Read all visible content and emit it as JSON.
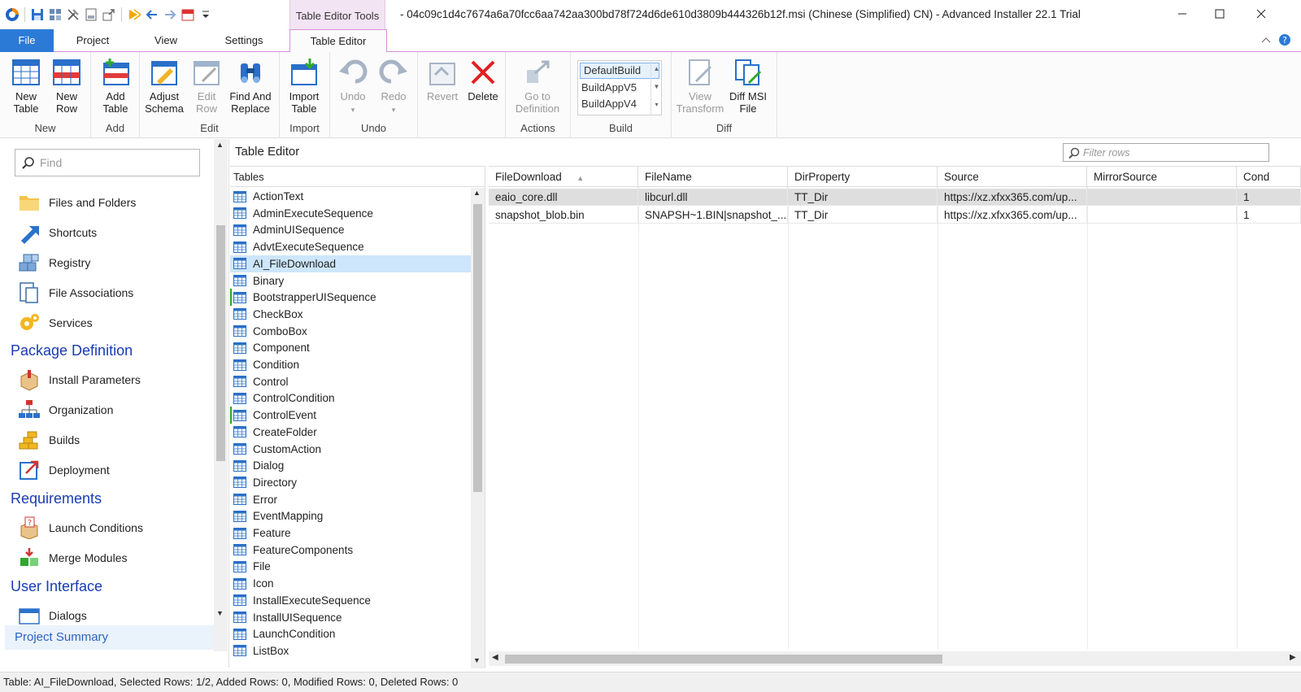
{
  "window": {
    "title": "- 04c09c1d4c7674a6a70fcc6aa742aa300bd78f724d6de610d3809b444326b12f.msi (Chinese (Simplified) CN) - Advanced Installer 22.1 Trial",
    "context_tab_title": "Table Editor Tools"
  },
  "tabs": [
    {
      "label": "File"
    },
    {
      "label": "Project"
    },
    {
      "label": "View"
    },
    {
      "label": "Settings"
    },
    {
      "label": "Table Editor"
    }
  ],
  "ribbon": {
    "new": {
      "label": "New",
      "new_table": "New\nTable",
      "new_row": "New\nRow"
    },
    "add": {
      "label": "Add",
      "add_table": "Add\nTable"
    },
    "edit": {
      "label": "Edit",
      "adjust_schema": "Adjust\nSchema",
      "edit_row": "Edit\nRow",
      "find_replace": "Find And\nReplace"
    },
    "import": {
      "label": "Import",
      "import_table": "Import\nTable"
    },
    "undo": {
      "label": "Undo",
      "undo": "Undo",
      "redo": "Redo"
    },
    "misc": {
      "revert": "Revert",
      "delete": "Delete"
    },
    "actions": {
      "label": "Actions",
      "go_to_definition": "Go to\nDefinition"
    },
    "build": {
      "label": "Build",
      "items": [
        "DefaultBuild",
        "BuildAppV5",
        "BuildAppV4"
      ],
      "selected": "DefaultBuild"
    },
    "diff": {
      "label": "Diff",
      "view_transform": "View\nTransform",
      "diff_msi": "Diff MSI\nFile"
    }
  },
  "leftpane": {
    "find_placeholder": "Find",
    "items_top": [
      {
        "label": "Files and Folders",
        "icon": "folder-icon"
      },
      {
        "label": "Shortcuts",
        "icon": "shortcut-arrow-icon"
      },
      {
        "label": "Registry",
        "icon": "registry-cubes-icon"
      },
      {
        "label": "File Associations",
        "icon": "file-association-icon"
      },
      {
        "label": "Services",
        "icon": "gears-icon"
      }
    ],
    "section_package": "Package Definition",
    "items_package": [
      {
        "label": "Install Parameters",
        "icon": "package-box-icon"
      },
      {
        "label": "Organization",
        "icon": "org-chart-icon"
      },
      {
        "label": "Builds",
        "icon": "bricks-icon"
      },
      {
        "label": "Deployment",
        "icon": "deploy-arrow-icon"
      }
    ],
    "section_requirements": "Requirements",
    "items_requirements": [
      {
        "label": "Launch Conditions",
        "icon": "question-box-icon"
      },
      {
        "label": "Merge Modules",
        "icon": "merge-modules-icon"
      }
    ],
    "section_ui": "User Interface",
    "items_ui": [
      {
        "label": "Dialogs",
        "icon": "dialog-window-icon"
      }
    ],
    "project_summary": "Project Summary"
  },
  "editor": {
    "title": "Table Editor",
    "filter_placeholder": "Filter rows",
    "tables_header": "Tables",
    "tables": [
      "ActionText",
      "AdminExecuteSequence",
      "AdminUISequence",
      "AdvtExecuteSequence",
      "AI_FileDownload",
      "Binary",
      "BootstrapperUISequence",
      "CheckBox",
      "ComboBox",
      "Component",
      "Condition",
      "Control",
      "ControlCondition",
      "ControlEvent",
      "CreateFolder",
      "CustomAction",
      "Dialog",
      "Directory",
      "Error",
      "EventMapping",
      "Feature",
      "FeatureComponents",
      "File",
      "Icon",
      "InstallExecuteSequence",
      "InstallUISequence",
      "LaunchCondition",
      "ListBox"
    ],
    "selected_table": "AI_FileDownload",
    "columns": [
      "FileDownload",
      "FileName",
      "DirProperty",
      "Source",
      "MirrorSource",
      "Cond"
    ],
    "rows": [
      [
        "eaio_core.dll",
        "libcurl.dll",
        "TT_Dir",
        "https://xz.xfxx365.com/up...",
        "",
        "1"
      ],
      [
        "snapshot_blob.bin",
        "SNAPSH~1.BIN|snapshot_...",
        "TT_Dir",
        "https://xz.xfxx365.com/up...",
        "",
        "1"
      ]
    ]
  },
  "status": "Table: AI_FileDownload, Selected Rows: 1/2, Added Rows: 0, Modified Rows: 0, Deleted Rows: 0"
}
